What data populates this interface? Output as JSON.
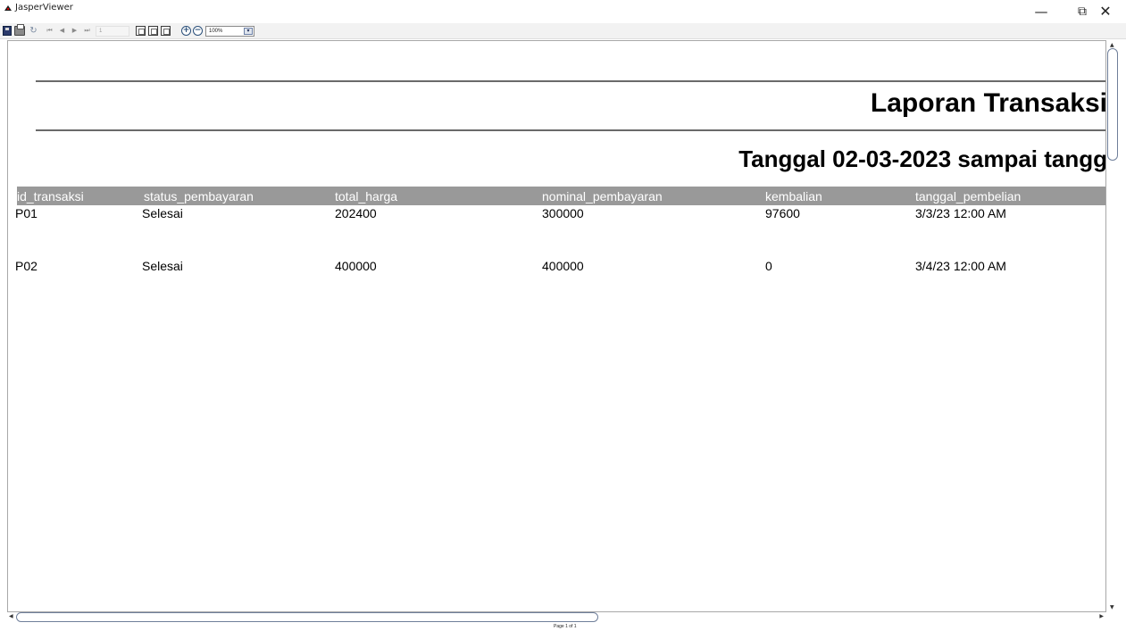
{
  "window": {
    "title": "JasperViewer",
    "min_glyph": "—",
    "max_glyph": "⧉",
    "close_glyph": "✕"
  },
  "toolbar": {
    "reload_glyph": "↻",
    "first_glyph": "⏮",
    "prev_glyph": "◀",
    "next_glyph": "▶",
    "last_glyph": "⏭",
    "page_number": "1",
    "zoom_in_glyph": "+",
    "zoom_out_glyph": "−",
    "zoom_value": "100%",
    "dropdown_glyph": "▾"
  },
  "report": {
    "title": "Laporan Transaksi",
    "subtitle": "Tanggal 02-03-2023 sampai tangg",
    "columns": [
      "id_transaksi",
      "status_pembayaran",
      "total_harga",
      "nominal_pembayaran",
      "kembalian",
      "tanggal_pembelian"
    ],
    "rows": [
      [
        "P01",
        "Selesai",
        "202400",
        "300000",
        "97600",
        "3/3/23 12:00 AM"
      ],
      [
        "P02",
        "Selesai",
        "400000",
        "400000",
        "0",
        "3/4/23 12:00 AM"
      ]
    ]
  },
  "scroll": {
    "up_glyph": "▲",
    "down_glyph": "▼",
    "left_glyph": "◀",
    "right_glyph": "▶"
  },
  "status": {
    "page_text": "Page 1 of 1"
  }
}
